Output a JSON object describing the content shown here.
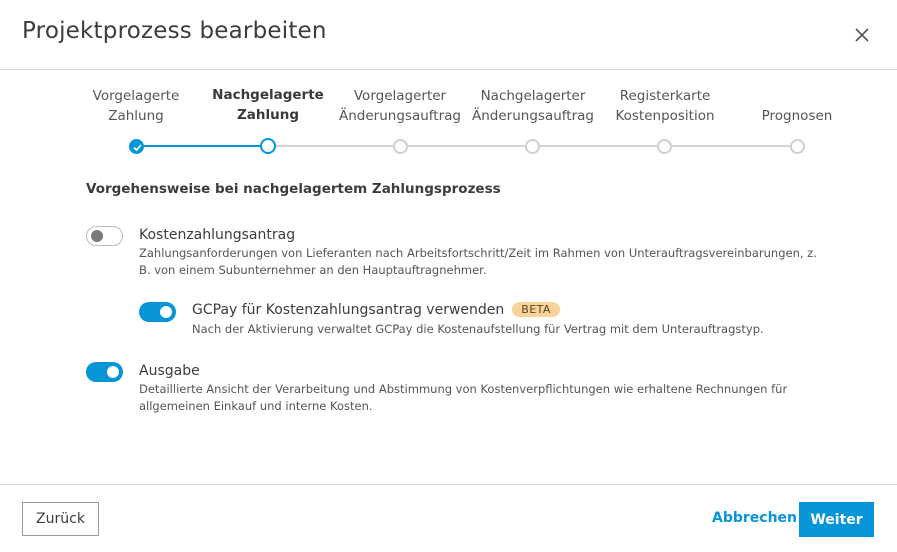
{
  "dialog": {
    "title": "Projektprozess bearbeiten",
    "close_icon": "close-icon"
  },
  "stepper": {
    "steps": [
      {
        "label_line1": "Vorgelagerte",
        "label_line2": "Zahlung",
        "state": "done"
      },
      {
        "label_line1": "Nachgelagerte",
        "label_line2": "Zahlung",
        "state": "current"
      },
      {
        "label_line1": "Vorgelagerter",
        "label_line2": "Änderungsauftrag",
        "state": "pending"
      },
      {
        "label_line1": "Nachgelagerter",
        "label_line2": "Änderungsauftrag",
        "state": "pending"
      },
      {
        "label_line1": "Registerkarte",
        "label_line2": "Kostenposition",
        "state": "pending"
      },
      {
        "label_line1": "",
        "label_line2": "Prognosen",
        "state": "pending"
      }
    ]
  },
  "section": {
    "title": "Vorgehensweise bei nachgelagertem Zahlungsprozess"
  },
  "options": [
    {
      "title": "Kostenzahlungsantrag",
      "enabled": false,
      "desc_line1": "Zahlungsanforderungen von Lieferanten nach Arbeitsfortschritt/Zeit im Rahmen von Unterauftragsvereinbarungen, z.",
      "desc_line2": "B. von einem Subunternehmer an den Hauptauftragnehmer."
    },
    {
      "title": "GCPay für Kostenzahlungsantrag verwenden",
      "badge": "BETA",
      "enabled": true,
      "desc_line1": "Nach der Aktivierung verwaltet GCPay die Kostenaufstellung für Vertrag mit dem Unterauftragstyp."
    },
    {
      "title": "Ausgabe",
      "enabled": true,
      "desc_line1": "Detaillierte Ansicht der Verarbeitung und Abstimmung von Kostenverpflichtungen wie erhaltene Rechnungen für",
      "desc_line2": "allgemeinen Einkauf und interne Kosten."
    }
  ],
  "footer": {
    "back_label": "Zurück",
    "cancel_label": "Abbrechen",
    "next_label": "Weiter"
  },
  "colors": {
    "accent": "#0696d7",
    "badge_bg": "#f9d49a",
    "track_pending": "#d6d6d6"
  }
}
